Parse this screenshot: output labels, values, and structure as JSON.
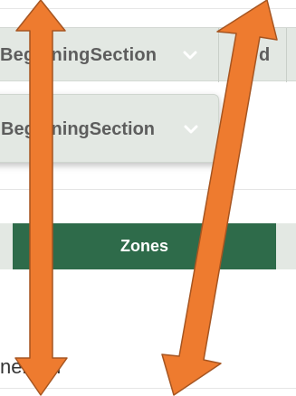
{
  "filter_bar": {
    "section_dropdown_label": "BeginningSection",
    "second_dropdown_label": "d"
  },
  "dropdown_panel": {
    "section_dropdown_label": "BeginningSection"
  },
  "tabs": {
    "active_tab_label": "Zones"
  },
  "list": {
    "item_label": "nerator"
  },
  "icons": {
    "dropdown_chevron": "chevron-down-icon",
    "annotation": "double-headed-arrow-icon"
  },
  "colors": {
    "accent_green": "#2e6b4a",
    "bar_background": "#e3e8e3",
    "arrow_orange": "#ee7b2f"
  }
}
